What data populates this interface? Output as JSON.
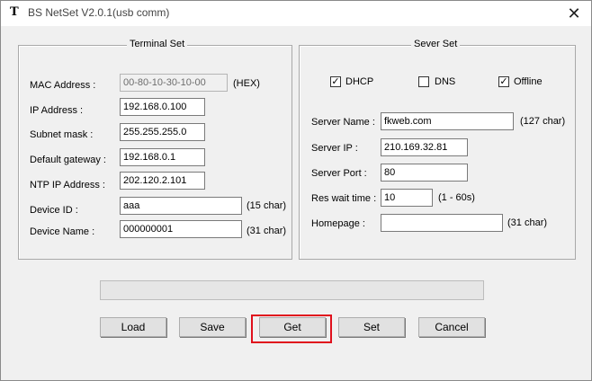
{
  "window": {
    "title": "BS NetSet V2.0.1(usb comm)",
    "icon_glyph": "T",
    "close_glyph": "✕"
  },
  "terminal": {
    "legend": "Terminal Set",
    "mac": {
      "label": "MAC  Address :",
      "value": "00-80-10-30-10-00",
      "suffix": "(HEX)"
    },
    "ip": {
      "label": "IP Address :",
      "value": "192.168.0.100"
    },
    "subnet": {
      "label": "Subnet mask  :",
      "value": "255.255.255.0"
    },
    "gateway": {
      "label": "Default gateway :",
      "value": "192.168.0.1"
    },
    "ntp": {
      "label": "NTP IP Address :",
      "value": "202.120.2.101"
    },
    "device_id": {
      "label": "Device ID  :",
      "value": "aaa",
      "suffix": "(15 char)"
    },
    "device_name": {
      "label": "Device Name :",
      "value": "000000001",
      "suffix": "(31 char)"
    }
  },
  "server": {
    "legend": "Sever Set",
    "dhcp": {
      "label": "DHCP",
      "checked": true
    },
    "dns": {
      "label": "DNS",
      "checked": false
    },
    "offline": {
      "label": "Offline",
      "checked": true
    },
    "check_glyph": "✓",
    "server_name": {
      "label": "Server Name :",
      "value": "fkweb.com",
      "suffix": "(127 char)"
    },
    "server_ip": {
      "label": "Server  IP  :",
      "value": "210.169.32.81"
    },
    "server_port": {
      "label": "Server Port :",
      "value": "80"
    },
    "res_wait": {
      "label": "Res wait time :",
      "value": "10",
      "suffix": "(1 -  60s)"
    },
    "homepage": {
      "label": "Homepage :",
      "value": "",
      "suffix": "(31 char)"
    }
  },
  "progress": {
    "fraction": 0.0
  },
  "buttons": {
    "load": "Load",
    "save": "Save",
    "get": "Get",
    "set": "Set",
    "cancel": "Cancel"
  },
  "colors": {
    "highlight": "#e0101c",
    "window_bg": "#f0f0f0"
  }
}
